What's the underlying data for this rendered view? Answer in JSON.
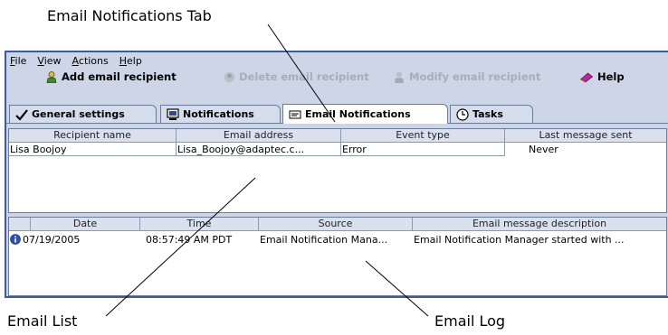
{
  "callouts": {
    "tab": "Email Notifications Tab",
    "list": "Email List",
    "log": "Email Log"
  },
  "menu": {
    "file": {
      "mnemonic": "F",
      "rest": "ile"
    },
    "view": {
      "mnemonic": "V",
      "rest": "iew"
    },
    "actions": {
      "mnemonic": "A",
      "rest": "ctions"
    },
    "help": {
      "mnemonic": "H",
      "rest": "elp"
    }
  },
  "toolbar": {
    "add": "Add email recipient",
    "delete": "Delete email recipient",
    "modify": "Modify email recipient",
    "help": "Help"
  },
  "tabs": {
    "general": "General settings",
    "notifications": "Notifications",
    "email": "Email Notifications",
    "tasks": "Tasks"
  },
  "email_list": {
    "headers": [
      "Recipient name",
      "Email address",
      "Event type",
      "Last message sent"
    ],
    "rows": [
      [
        "Lisa Boojoy",
        "Lisa_Boojoy@adaptec.c...",
        "Error",
        "Never"
      ]
    ]
  },
  "email_log": {
    "headers": [
      "Date",
      "Time",
      "Source",
      "Email message description"
    ],
    "rows": [
      [
        "07/19/2005",
        "08:57:49 AM PDT",
        "Email Notification Mana...",
        "Email Notification Manager started with ..."
      ]
    ]
  },
  "colors": {
    "window_border": "#3a59a8",
    "window_bg": "#ccd6e6",
    "header_bg": "#d9e1ee",
    "info_icon": "#2850b8",
    "disabled_text": "#a7aeb8"
  },
  "icons": {
    "add": "user-add-icon",
    "delete": "user-delete-icon",
    "modify": "user-modify-icon",
    "help": "help-book-icon",
    "general": "checkmark-icon",
    "notifications": "monitor-icon",
    "email": "envelope-icon",
    "tasks": "clock-icon",
    "log_entry": "info-icon"
  }
}
